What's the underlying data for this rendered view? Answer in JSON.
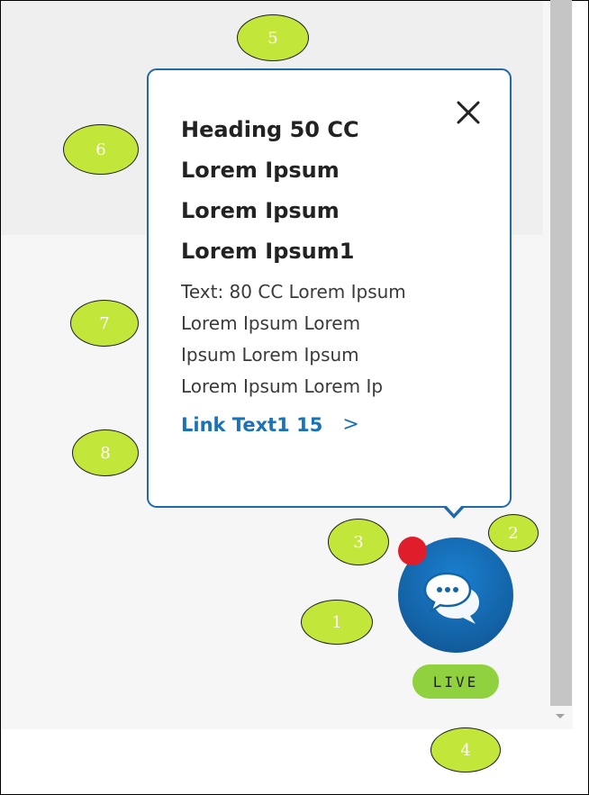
{
  "popover": {
    "heading_lines": [
      "Heading 50 CC",
      "Lorem Ipsum",
      "Lorem Ipsum",
      "Lorem Ipsum1"
    ],
    "body_lines": [
      "Text: 80 CC Lorem Ipsum",
      "Lorem Ipsum Lorem",
      "Ipsum Lorem Ipsum",
      "Lorem Ipsum Lorem Ip"
    ],
    "link_text": "Link Text1 15",
    "link_chevron": ">",
    "close_icon": "close-icon"
  },
  "chat_button": {
    "icon": "chat-bubbles-icon",
    "live_label": "LIVE",
    "notification_dot_color": "#e01d2a",
    "button_color": "#1464a8",
    "live_badge_color": "#8fd13f"
  },
  "markers": [
    "1",
    "2",
    "3",
    "4",
    "5",
    "6",
    "7",
    "8"
  ],
  "colors": {
    "accent": "#1f6aa8",
    "link": "#1a73b8",
    "marker_fill": "#c3e63a"
  }
}
